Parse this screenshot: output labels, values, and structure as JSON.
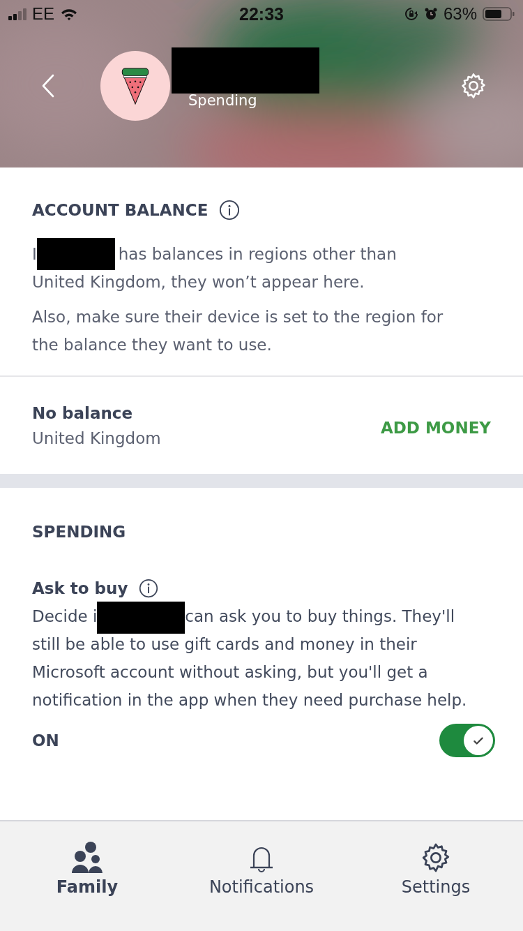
{
  "status_bar": {
    "carrier": "EE",
    "time": "22:33",
    "battery": "63%"
  },
  "header": {
    "subtitle": "Spending"
  },
  "account_balance": {
    "title": "ACCOUNT BALANCE",
    "text_before": "I",
    "text_after": "has balances in regions other than",
    "text_rest": "United Kingdom, they won’t appear here.",
    "note": "Also, make sure their device is set to the region for the balance they want to use."
  },
  "balance": {
    "amount": "No balance",
    "region": "United Kingdom",
    "action": "ADD MONEY"
  },
  "spending": {
    "title": "SPENDING",
    "setting_title": "Ask to buy",
    "text_before": "Decide i",
    "text_after": "can ask you to buy things. They'll",
    "text_rest": "still be able to use gift cards and money in their Microsoft account without asking, but you'll get a notification in the app when they need purchase help.",
    "state_label": "ON",
    "on": true
  },
  "tabs": [
    {
      "label": "Family",
      "kind": "family",
      "selected": true
    },
    {
      "label": "Notifications",
      "kind": "bell",
      "selected": false
    },
    {
      "label": "Settings",
      "kind": "gear",
      "selected": false
    }
  ]
}
